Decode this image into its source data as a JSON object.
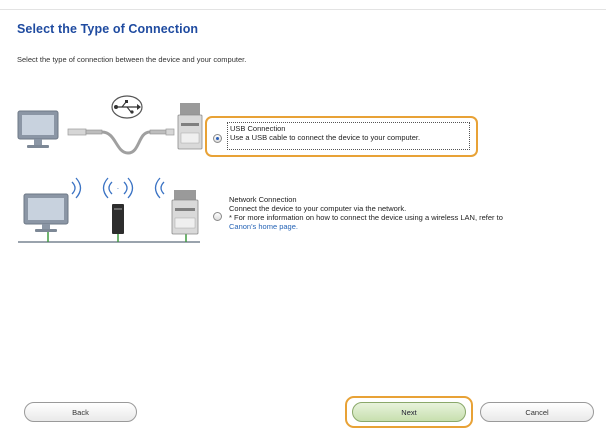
{
  "header": {
    "title": "Select the Type of Connection",
    "subtitle": "Select the type of connection between the device and your computer."
  },
  "options": {
    "usb": {
      "label": "USB Connection",
      "description": "Use a USB cable to connect the device to your computer.",
      "selected": true
    },
    "network": {
      "label": "Network Connection",
      "description": "Connect the device to your computer via the network.",
      "note": "* For more information on how to connect the device using a wireless LAN, refer to",
      "link_text": "Canon's home page.",
      "selected": false
    }
  },
  "buttons": {
    "back": "Back",
    "next": "Next",
    "cancel": "Cancel"
  },
  "colors": {
    "title": "#1f4ba0",
    "highlight": "#e8a236",
    "link": "#2563b5",
    "next_button": "#c7dfae"
  },
  "icons": [
    "monitor-icon",
    "usb-symbol-icon",
    "usb-cable-icon",
    "printer-icon",
    "wifi-signal-icon",
    "wireless-router-icon",
    "network-line-icon"
  ]
}
